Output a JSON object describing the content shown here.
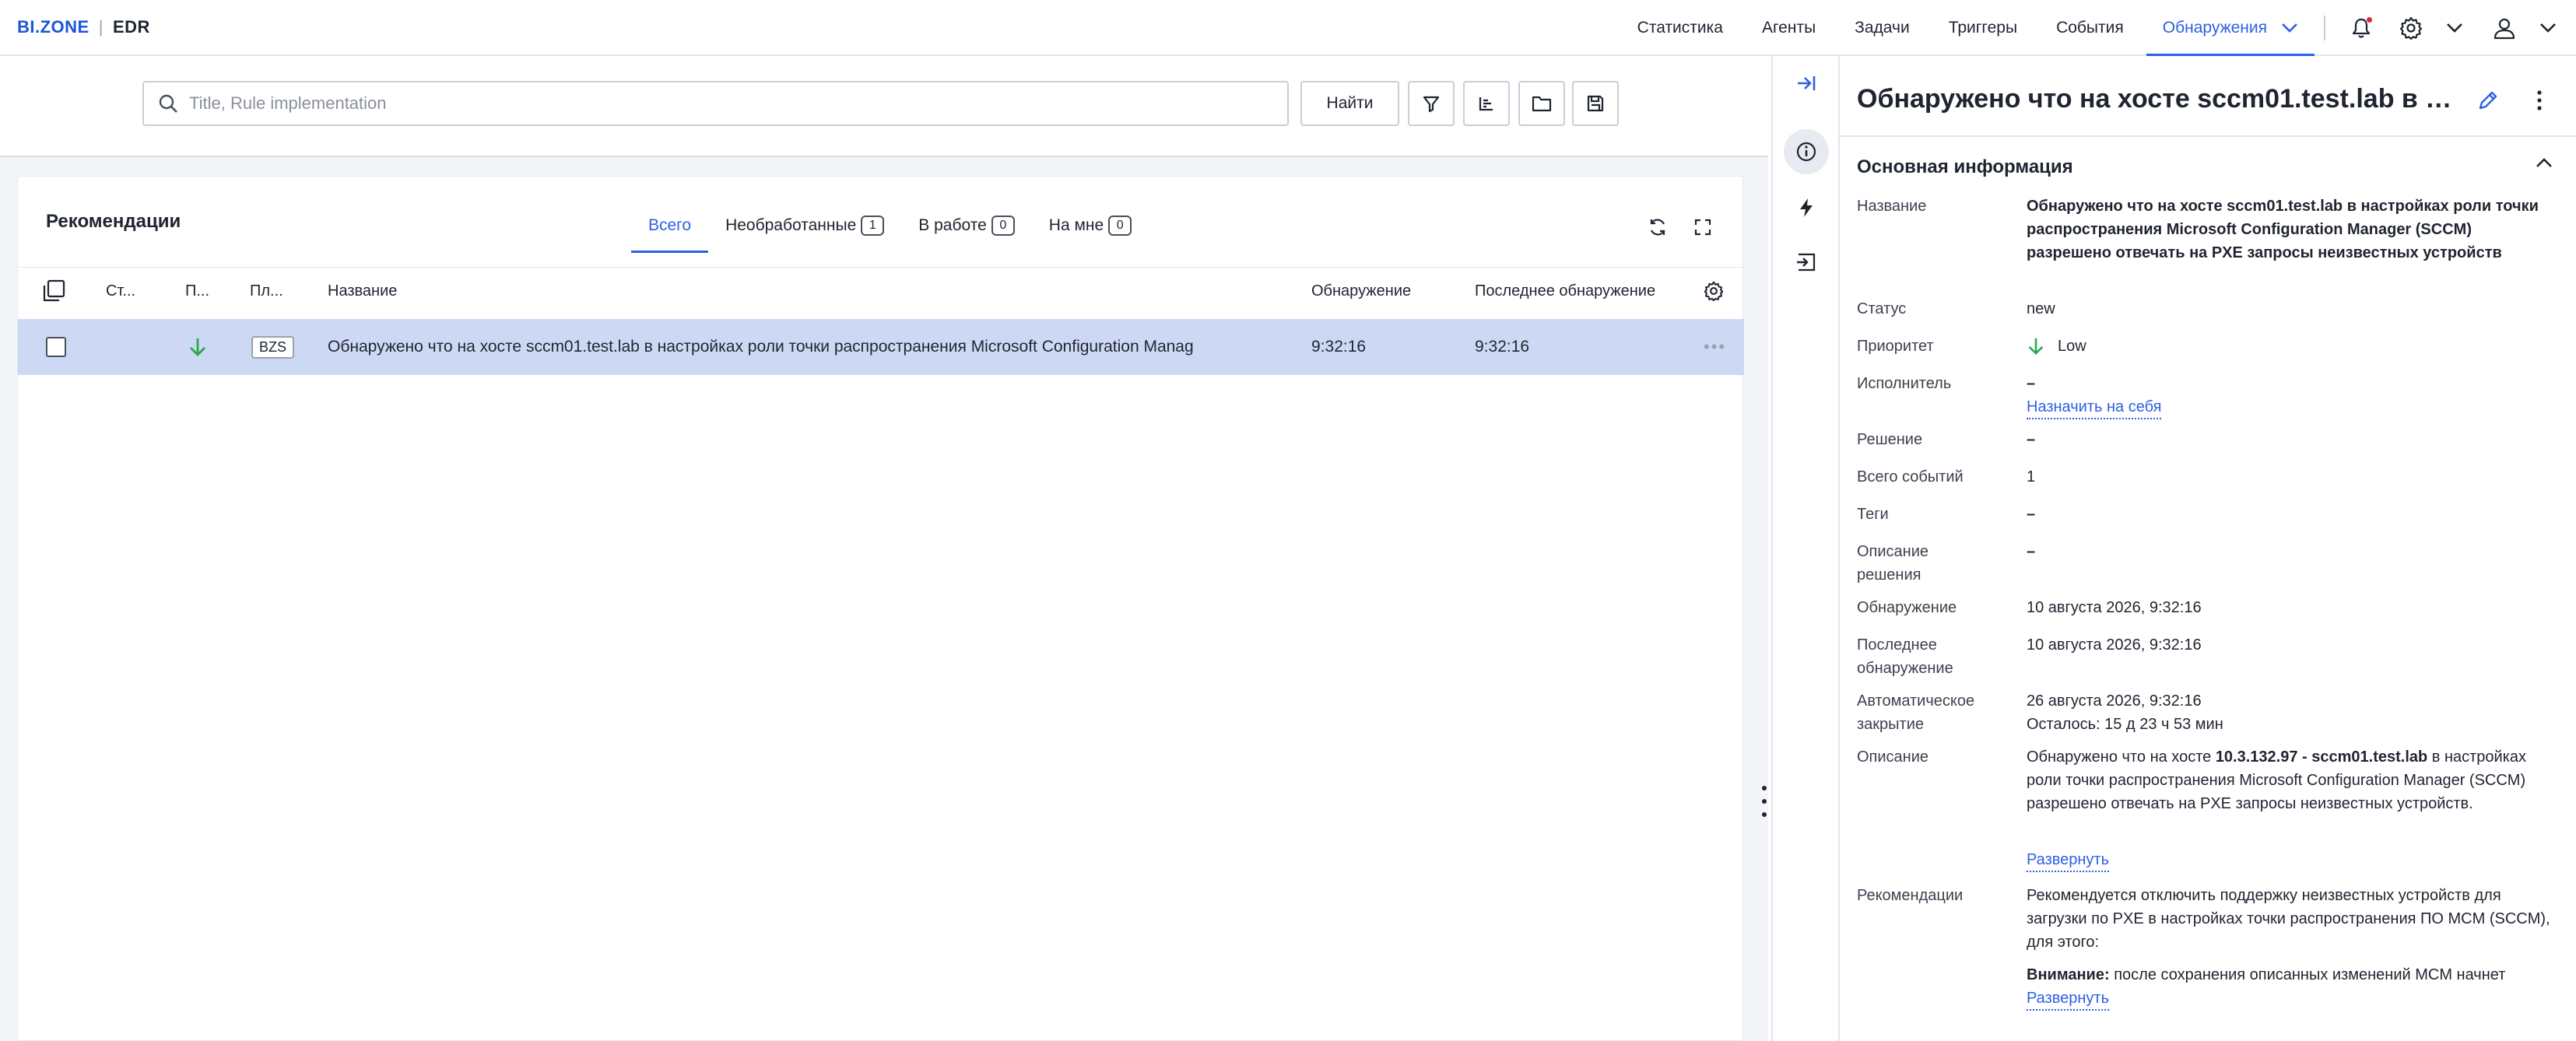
{
  "brand": {
    "name": "BI.ZONE",
    "product": "EDR"
  },
  "nav": {
    "items": [
      "Статистика",
      "Агенты",
      "Задачи",
      "Триггеры",
      "События",
      "Обнаружения"
    ],
    "active_index": 5,
    "icons": [
      "bell-icon",
      "gear-icon",
      "chevron-down-icon",
      "user-icon",
      "chevron-down-icon"
    ]
  },
  "search": {
    "placeholder": "Title, Rule implementation",
    "value": "",
    "find_label": "Найти",
    "tool_icons": [
      "filter-icon",
      "sort-icon",
      "folder-icon",
      "save-icon"
    ]
  },
  "list": {
    "title": "Рекомендации",
    "tabs": [
      {
        "label": "Всего",
        "count": null
      },
      {
        "label": "Необработанные",
        "count": "1"
      },
      {
        "label": "В работе",
        "count": "0"
      },
      {
        "label": "На мне",
        "count": "0"
      }
    ],
    "active_tab": 0,
    "columns": {
      "status": "Ст...",
      "priority": "П...",
      "platform": "Пл...",
      "name": "Название",
      "detected": "Обнаружение",
      "last_detected": "Последнее обнаружение"
    },
    "rows": [
      {
        "priority_icon": "arrow-down-icon",
        "platform": "BZS",
        "name": "Обнаружено что на хосте sccm01.test.lab в настройках роли точки распространения Microsoft Configuration Manag",
        "detected": "9:32:16",
        "last_detected": "9:32:16",
        "selected": true
      }
    ]
  },
  "details": {
    "title": "Обнаружено что на хосте sccm01.test.lab в н...",
    "section_title": "Основная информация",
    "fields": {
      "name_label": "Название",
      "name_value": "Обнаружено что на хосте sccm01.test.lab в настройках роли точки распространения Microsoft Configuration Manager (SCCM) разрешено отвечать на PXE запросы неизвестных устройств",
      "status_label": "Статус",
      "status_value": "new",
      "priority_label": "Приоритет",
      "priority_value": "Low",
      "assignee_label": "Исполнитель",
      "assignee_value": "–",
      "assign_self_link": "Назначить на себя",
      "resolution_label": "Решение",
      "resolution_value": "–",
      "events_label": "Всего событий",
      "events_value": "1",
      "tags_label": "Теги",
      "tags_value": "–",
      "resolution_desc_label_1": "Описание",
      "resolution_desc_label_2": "решения",
      "resolution_desc_value": "–",
      "detected_label": "Обнаружение",
      "detected_value": "10 августа 2026, 9:32:16",
      "last_detected_label_1": "Последнее",
      "last_detected_label_2": "обнаружение",
      "last_detected_value": "10 августа 2026, 9:32:16",
      "auto_close_label_1": "Автоматическое",
      "auto_close_label_2": "закрытие",
      "auto_close_value": "26 августа 2026, 9:32:16",
      "auto_close_remaining": "Осталось: 15 д 23 ч 53 мин",
      "description_label": "Описание",
      "description_prefix": "Обнаружено что на хосте ",
      "description_host": "10.3.132.97 - sccm01.test.lab",
      "description_suffix": " в настройках роли точки распространения Microsoft Configuration Manager (SCCM) разрешено отвечать на PXE запросы неизвестных устройств.",
      "expand_link": "Развернуть",
      "recommendations_label": "Рекомендации",
      "recommendations_value": "Рекомендуется отключить поддержку неизвестных устройств для загрузки по PXE в настройках точки распространения ПО MCM (SCCM), для этого:",
      "warning_bold": "Внимание:",
      "warning_text": " после сохранения описанных изменений MCM начнет",
      "expand_link_2": "Развернуть"
    }
  },
  "colors": {
    "accent": "#2c60e3",
    "selected_row": "#cdd9f4",
    "priority_low": "#2aa84a",
    "brand": "#1a57d6"
  }
}
